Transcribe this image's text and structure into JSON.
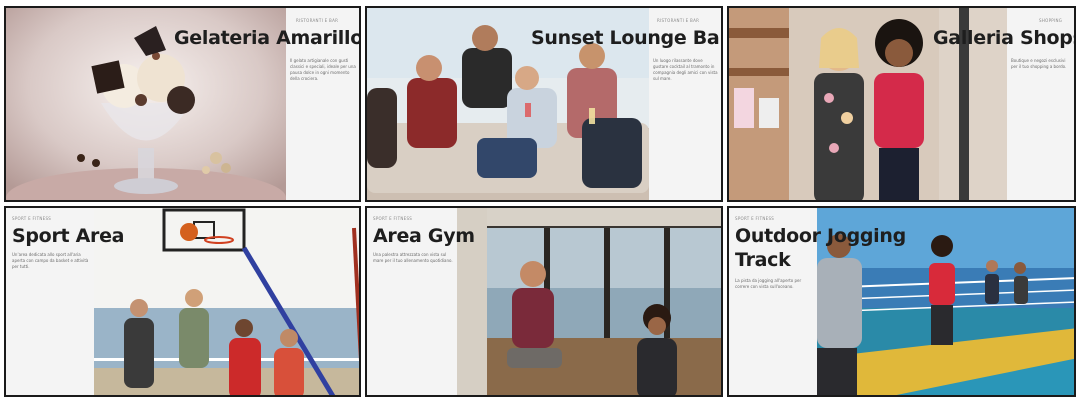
{
  "cards": [
    {
      "title": "Gelateria Amarillo",
      "tag": "RISTORANTI E BAR",
      "desc": "Il gelato artigianale con gusti classici e speciali, ideale per una pausa dolce in ogni momento della crociera."
    },
    {
      "title": "Sunset Lounge Bar",
      "tag": "RISTORANTI E BAR",
      "desc": "Un luogo rilassante dove gustare cocktail al tramonto in compagnia degli amici con vista sul mare."
    },
    {
      "title": "Galleria Shops",
      "tag": "SHOPPING",
      "desc": "Boutique e negozi esclusivi per il tuo shopping a bordo."
    },
    {
      "title": "Sport Area",
      "tag": "SPORT E FITNESS",
      "desc": "Un'area dedicata allo sport all'aria aperta con campo da basket e attività per tutti."
    },
    {
      "title": "Area Gym",
      "tag": "SPORT E FITNESS",
      "desc": "Una palestra attrezzata con vista sul mare per il tuo allenamento quotidiano."
    },
    {
      "title_line1": "Outdoor Jogging",
      "title_line2": "Track",
      "tag": "SPORT E FITNESS",
      "desc": "La pista da jogging all'aperto per correre con vista sull'oceano."
    }
  ]
}
